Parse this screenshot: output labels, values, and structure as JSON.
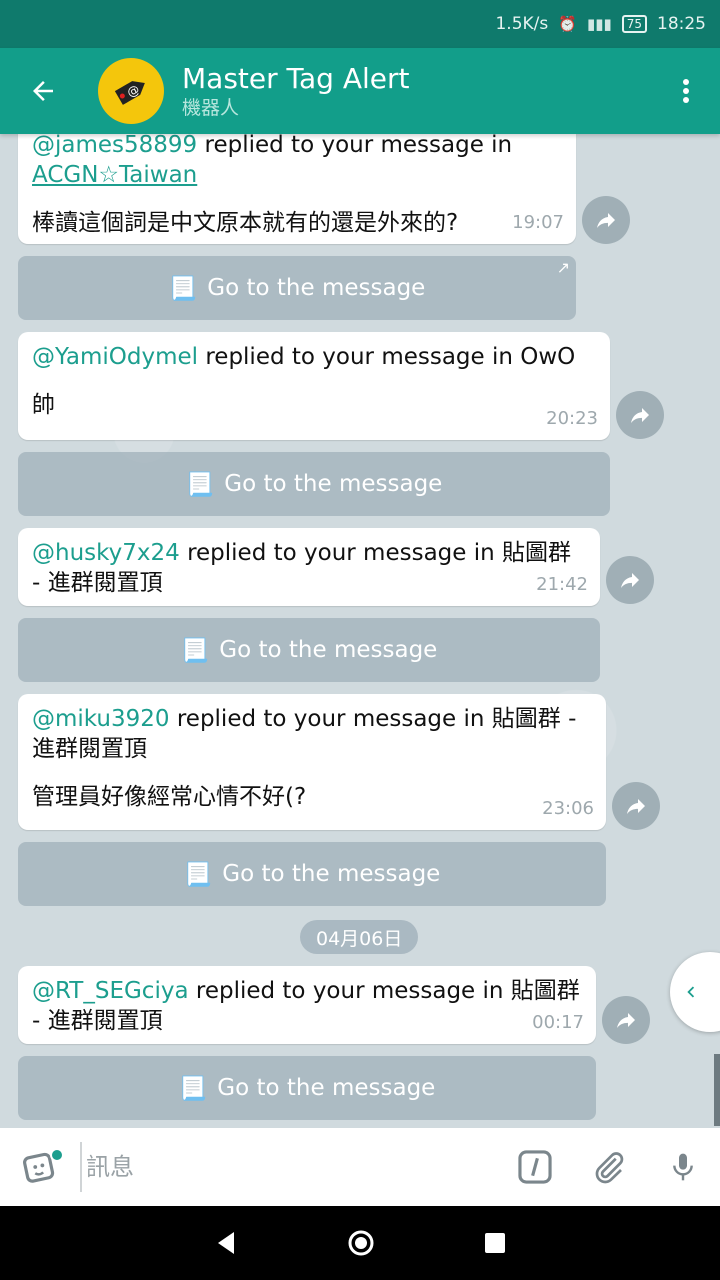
{
  "status_bar": {
    "speed": "1.5K/s",
    "battery": "75",
    "time": "18:25"
  },
  "header": {
    "title": "Master Tag Alert",
    "subtitle": "機器人"
  },
  "messages": [
    {
      "user": "@james58899",
      "text": " replied to your message in",
      "group_link": "ACGN☆Taiwan",
      "body": "棒讀這個詞是中文原本就有的還是外來的?",
      "time": "19:07",
      "button": "Go to the message"
    },
    {
      "user": "@YamiOdymel",
      "text": " replied to your message in OwO",
      "body": "帥",
      "time": "20:23",
      "button": "Go to the message"
    },
    {
      "user": "@husky7x24",
      "text": " replied to your message in 貼圖群 - 進群閱置頂",
      "time": "21:42",
      "button": "Go to the message"
    },
    {
      "user": "@miku3920",
      "text": " replied to your message in 貼圖群 - 進群閱置頂",
      "body": "管理員好像經常心情不好(?",
      "time": "23:06",
      "button": "Go to the message"
    },
    {
      "user": "@RT_SEGciya",
      "text": " replied to your message in 貼圖群 - 進群閱置頂",
      "time": "00:17",
      "button": "Go to the message"
    }
  ],
  "date_divider": "04月06日",
  "input": {
    "placeholder": "訊息"
  },
  "colors": {
    "header": "#129e8a",
    "statusbar": "#0f7a6c",
    "accent": "#1c9e8e"
  }
}
